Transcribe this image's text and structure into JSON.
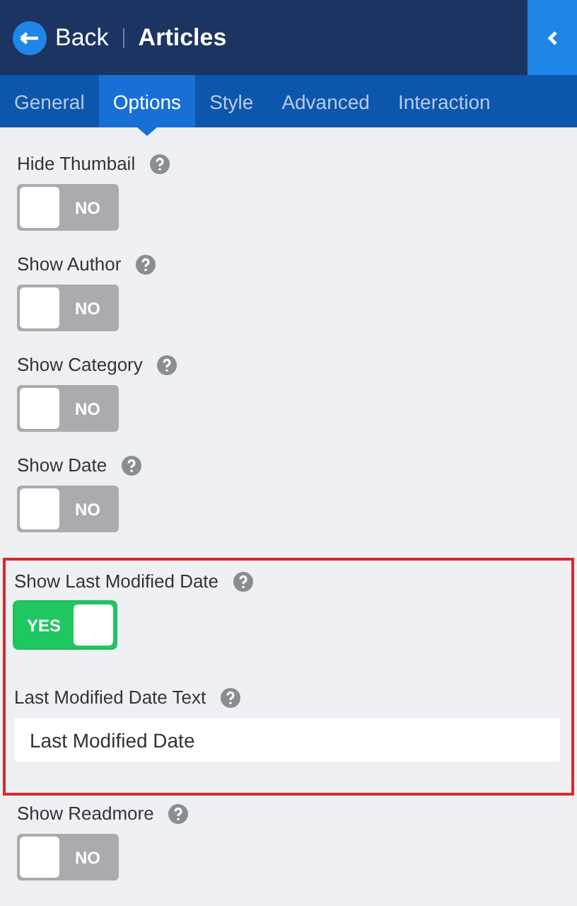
{
  "header": {
    "back_label": "Back",
    "title": "Articles"
  },
  "tabs": [
    {
      "label": "General",
      "selected": false
    },
    {
      "label": "Options",
      "selected": true
    },
    {
      "label": "Style",
      "selected": false
    },
    {
      "label": "Advanced",
      "selected": false
    },
    {
      "label": "Interaction",
      "selected": false
    }
  ],
  "groups": [
    {
      "highlighted": false,
      "fields": [
        {
          "kind": "toggle",
          "label": "Hide Thumbail",
          "on": false,
          "state_text": "NO"
        }
      ]
    },
    {
      "highlighted": false,
      "fields": [
        {
          "kind": "toggle",
          "label": "Show Author",
          "on": false,
          "state_text": "NO"
        }
      ]
    },
    {
      "highlighted": false,
      "fields": [
        {
          "kind": "toggle",
          "label": "Show Category",
          "on": false,
          "state_text": "NO"
        }
      ]
    },
    {
      "highlighted": false,
      "fields": [
        {
          "kind": "toggle",
          "label": "Show Date",
          "on": false,
          "state_text": "NO"
        }
      ]
    },
    {
      "highlighted": true,
      "fields": [
        {
          "kind": "toggle",
          "label": "Show Last Modified Date",
          "on": true,
          "state_text": "YES"
        },
        {
          "kind": "text",
          "label": "Last Modified Date Text",
          "value": "Last Modified Date"
        }
      ]
    },
    {
      "highlighted": false,
      "fields": [
        {
          "kind": "toggle",
          "label": "Show Readmore",
          "on": false,
          "state_text": "NO"
        }
      ]
    }
  ]
}
